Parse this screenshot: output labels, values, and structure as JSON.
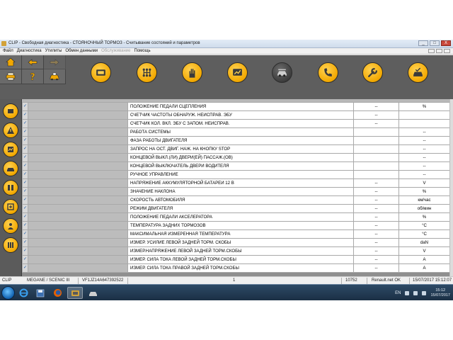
{
  "window": {
    "title": "CLIP - Свободная диагностика - СТОЯНОЧНЫЙ ТОРМОЗ - Считывание состояний и параметров",
    "controls": [
      "_",
      "□",
      "X"
    ]
  },
  "menu": {
    "items": [
      {
        "label": "Файл",
        "enabled": true
      },
      {
        "label": "Диагностика",
        "enabled": true
      },
      {
        "label": "Утилиты",
        "enabled": true
      },
      {
        "label": "Обмен данными",
        "enabled": true
      },
      {
        "label": "Обслуживание",
        "enabled": false
      },
      {
        "label": "Помощь",
        "enabled": true
      }
    ]
  },
  "toolbar": {
    "nav_buttons": [
      "home-icon",
      "arrow-left-icon",
      "arrow-right-icon",
      "printer-icon",
      "help-icon",
      "car-warning-icon"
    ],
    "gauge_buttons": [
      "ecu-icon",
      "gearbox-icon",
      "hand-icon",
      "display-icon",
      "brake-icon",
      "phone-car-icon",
      "wrench-icon",
      "car-check-icon"
    ],
    "active_gauge": 4,
    "accent_color": "#f2a800"
  },
  "sidebar": {
    "buttons": [
      "ecu-list-icon",
      "warning-icon",
      "parameters-icon",
      "car-check-icon",
      "actuators-icon",
      "config-icon",
      "network-icon",
      "settings-icon"
    ]
  },
  "table": {
    "rows": [
      {
        "id": "",
        "name": "ПОЛОЖЕНИЕ ПЕДАЛИ СЦЕПЛЕНИЯ",
        "value": "--",
        "unit": "%"
      },
      {
        "id": "",
        "name": "СЧЕТЧИК ЧАСТОТЫ ОБНАРУЖ. НЕИСПРАВ. ЭБУ",
        "value": "--",
        "unit": ""
      },
      {
        "id": "",
        "name": "СЧЕТЧИК КОЛ. ВКЛ. ЭБУ С ЗАПОМ. НЕИСПРАВ.",
        "value": "--",
        "unit": ""
      },
      {
        "id": "",
        "name": "РАБОТА СИСТЕМЫ",
        "value": "",
        "unit": "--"
      },
      {
        "id": "",
        "name": "ФАЗА РАБОТЫ ДВИГАТЕЛЯ",
        "value": "",
        "unit": "--"
      },
      {
        "id": "",
        "name": "ЗАПРОС НА ОСТ. ДВИГ. НАЖ. НА КНОПКУ STOP",
        "value": "",
        "unit": "--"
      },
      {
        "id": "",
        "name": "КОНЦЕВОЙ ВЫКЛ.(ЛИ) ДВЕРИ(ЕЙ) ПАССАЖ.(ОВ)",
        "value": "",
        "unit": "--"
      },
      {
        "id": "",
        "name": "КОНЦЕВОЙ ВЫКЛЮЧАТЕЛЬ ДВЕРИ ВОДИТЕЛЯ",
        "value": "",
        "unit": "--"
      },
      {
        "id": "",
        "name": "РУЧНОЕ УПРАВЛЕНИЕ",
        "value": "",
        "unit": "--"
      },
      {
        "id": "",
        "name": "НАПРЯЖЕНИЕ АККУМУЛЯТОРНОЙ БАТАРЕИ 12 В",
        "value": "--",
        "unit": "V"
      },
      {
        "id": "",
        "name": "ЗНАЧЕНИЕ НАКЛОНА",
        "value": "--",
        "unit": "%"
      },
      {
        "id": "",
        "name": "СКОРОСТЬ АВТОМОБИЛЯ",
        "value": "--",
        "unit": "км/час"
      },
      {
        "id": "",
        "name": "РЕЖИМ ДВИГАТЕЛЯ",
        "value": "--",
        "unit": "об/мин"
      },
      {
        "id": "",
        "name": "ПОЛОЖЕНИЕ ПЕДАЛИ АКСЕЛЕРАТОРА",
        "value": "--",
        "unit": "%"
      },
      {
        "id": "",
        "name": "ТЕМПЕРАТУРА ЗАДНИХ ТОРМОЗОВ",
        "value": "--",
        "unit": "°C"
      },
      {
        "id": "",
        "name": "МАКСИМАЛЬНАЯ ИЗМЕРЕННАЯ ТЕМПЕРАТУРА",
        "value": "--",
        "unit": "°C"
      },
      {
        "id": "",
        "name": "ИЗМЕР. УСИЛИЕ ЛЕВОЙ ЗАДНЕЙ ТОРМ. СКОБЫ",
        "value": "--",
        "unit": "daN"
      },
      {
        "id": "",
        "name": "ИЗМЕР.НАПРЯЖЕНИЕ ЛЕВОЙ ЗАДНЕЙ ТОРМ.СКОБЫ",
        "value": "--",
        "unit": "V"
      },
      {
        "id": "",
        "name": "ИЗМЕР. СИЛА ТОКА ЛЕВОЙ ЗАДНЕЙ ТОРМ.СКОБЫ",
        "value": "--",
        "unit": "A"
      },
      {
        "id": "",
        "name": "ИЗМЕР. СИЛА ТОКА ПРАВОЙ ЗАДНЕЙ ТОРМ.СКОБЫ",
        "value": "--",
        "unit": "A"
      }
    ]
  },
  "statusbar": {
    "clip": "CLIP",
    "vehicle": "MEGANE / SCENIC III",
    "vin": "VF1JZ14A647392522",
    "page": "1",
    "code": "10752",
    "connection": "Renault.net OK",
    "datetime": "15/07/2017 15:12:07"
  },
  "taskbar": {
    "apps": [
      "ie-icon",
      "save-icon",
      "firefox-icon",
      "clip-app-icon",
      "diag-icon"
    ],
    "language": "EN",
    "time": "15:12",
    "date": "15/07/2017"
  }
}
